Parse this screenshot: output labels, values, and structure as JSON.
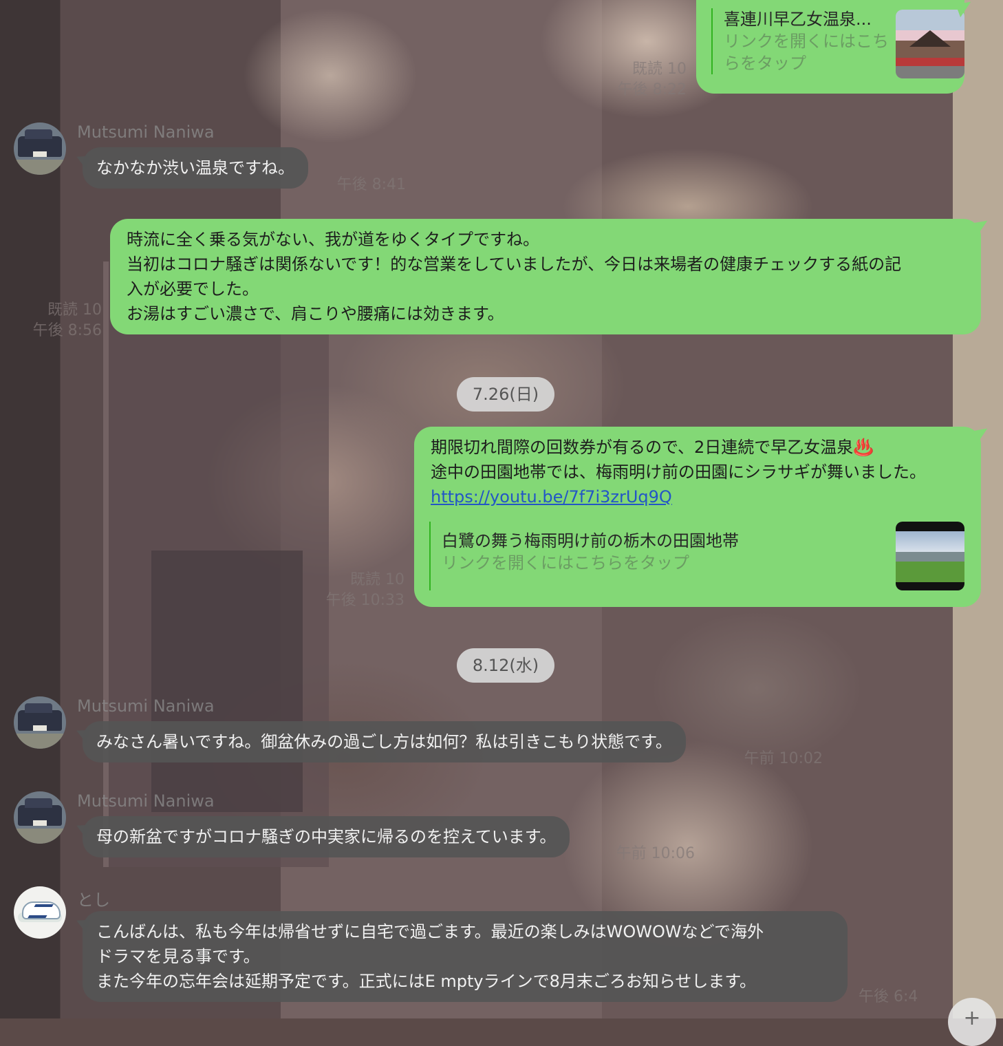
{
  "messages": {
    "m1": {
      "preview_title": "喜連川早乙女温泉...",
      "preview_sub": "リンクを開くにはこちらをタップ",
      "read": "既読 10",
      "time": "午後 8:22"
    },
    "m2": {
      "sender": "Mutsumi Naniwa",
      "text": "なかなか渋い温泉ですね。",
      "time": "午後 8:41"
    },
    "m3": {
      "line1": "時流に全く乗る気がない、我が道をゆくタイプですね。",
      "line2": "当初はコロナ騒ぎは関係ないです！的な営業をしていましたが、今日は来場者の健康チェックする紙の記",
      "line3": "入が必要でした。",
      "line4": "お湯はすごい濃さで、肩こりや腰痛には効きます。",
      "read": "既読 10",
      "time": "午後 8:56"
    },
    "date1": "7.26(日)",
    "m4": {
      "line1": "期限切れ間際の回数券が有るので、2日連続で早乙女温泉♨️",
      "line2": "途中の田園地帯では、梅雨明け前の田園にシラサギが舞いました。",
      "link": "https://youtu.be/7f7i3zrUq9Q",
      "preview_title": "白鷺の舞う梅雨明け前の栃木の田園地帯",
      "preview_sub": "リンクを開くにはこちらをタップ",
      "read": "既読 10",
      "time": "午後 10:33"
    },
    "date2": "8.12(水)",
    "m5": {
      "sender": "Mutsumi Naniwa",
      "text": "みなさん暑いですね。御盆休みの過ごし方は如何？私は引きこもり状態です。",
      "time": "午前 10:02"
    },
    "m6": {
      "sender": "Mutsumi Naniwa",
      "text": "母の新盆ですがコロナ騒ぎの中実家に帰るのを控えています。",
      "time": "午前 10:06"
    },
    "m7": {
      "sender": "とし",
      "line1": "こんばんは、私も今年は帰省せずに自宅で過ごます。最近の楽しみはWOWOWなどで海外",
      "line2": "ドラマを見る事です。",
      "line3": "また今年の忘年会は延期予定です。正式にはE mptyラインで8月末ごろお知らせします。",
      "time": "午後 6:4"
    }
  },
  "icons": {
    "car_avatar": "car-photo-avatar",
    "shoe_avatar": "sneaker-photo-avatar",
    "scroll": "scroll-down-icon"
  },
  "colors": {
    "outgoing_bubble": "#83d876",
    "incoming_bubble": "#555555",
    "link": "#2356c6"
  }
}
